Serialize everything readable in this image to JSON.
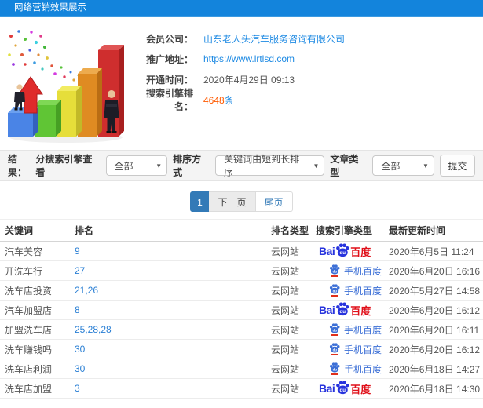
{
  "header": {
    "title": "网络营销效果展示"
  },
  "info": {
    "member_label": "会员公司：",
    "member_value": "山东老人头汽车服务咨询有限公司",
    "url_label": "推广地址：",
    "url_value": "https://www.lrtlsd.com",
    "opened_label": "开通时间：",
    "opened_value": "2020年4月29日 09:13",
    "rank_label": "搜索引擎排名：",
    "rank_count": "4648",
    "rank_unit": "条"
  },
  "filters": {
    "result_label": "结果：",
    "engine_label": "分搜索引擎查看",
    "engine_value": "全部",
    "sort_label": "排序方式",
    "sort_value": "关键词由短到长排序",
    "article_label": "文章类型",
    "article_value": "全部",
    "submit_label": "提交"
  },
  "pagination": {
    "current": "1",
    "next": "下一页",
    "last": "尾页"
  },
  "table": {
    "columns": [
      "关键词",
      "排名",
      "排名类型",
      "搜索引擎类型",
      "最新更新时间"
    ],
    "rows": [
      {
        "keyword": "汽车美容",
        "rank": "9",
        "rank_type": "云网站",
        "engine": "baidu",
        "updated": "2020年6月5日 11:24"
      },
      {
        "keyword": "开洗车行",
        "rank": "27",
        "rank_type": "云网站",
        "engine": "mobile_baidu",
        "updated": "2020年6月20日 16:16"
      },
      {
        "keyword": "洗车店投资",
        "rank": "21,26",
        "rank_type": "云网站",
        "engine": "mobile_baidu",
        "updated": "2020年5月27日 14:58"
      },
      {
        "keyword": "汽车加盟店",
        "rank": "8",
        "rank_type": "云网站",
        "engine": "baidu",
        "updated": "2020年6月20日 16:12"
      },
      {
        "keyword": "加盟洗车店",
        "rank": "25,28,28",
        "rank_type": "云网站",
        "engine": "mobile_baidu",
        "updated": "2020年6月20日 16:11"
      },
      {
        "keyword": "洗车赚钱吗",
        "rank": "30",
        "rank_type": "云网站",
        "engine": "mobile_baidu",
        "updated": "2020年6月20日 16:12"
      },
      {
        "keyword": "洗车店利润",
        "rank": "30",
        "rank_type": "云网站",
        "engine": "mobile_baidu",
        "updated": "2020年6月18日 14:27"
      },
      {
        "keyword": "洗车店加盟",
        "rank": "3",
        "rank_type": "云网站",
        "engine": "baidu",
        "updated": "2020年6月18日 14:30"
      }
    ]
  },
  "engines": {
    "baidu": {
      "bai": "Bai",
      "du": "du",
      "name": "百度"
    },
    "mobile_baidu": {
      "label": "手机百度"
    }
  },
  "colors": {
    "header_blue": "#1384dc",
    "link_blue": "#1e8ae3",
    "rank_orange": "#ff5a00",
    "baidu_blue": "#2733dd",
    "baidu_red": "#e0101a",
    "mobile_baidu_blue": "#3c6fd6",
    "pagination_active": "#337ab7"
  }
}
